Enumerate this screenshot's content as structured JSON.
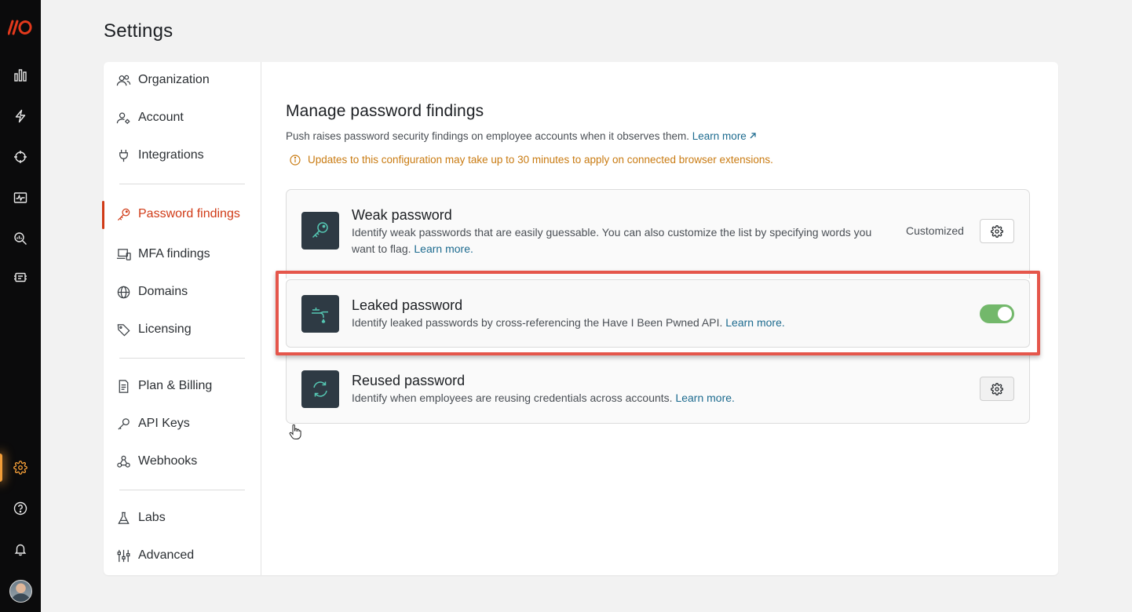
{
  "app": {
    "logo_text": "//O",
    "brand_color": "#e3391c",
    "accent_color": "#f29d38"
  },
  "rail": {
    "items": [
      {
        "icon": "bar-chart-icon"
      },
      {
        "icon": "lightning-icon"
      },
      {
        "icon": "crosshair-icon"
      },
      {
        "icon": "activity-monitor-icon"
      },
      {
        "icon": "search-analytics-icon"
      },
      {
        "icon": "browser-extension-icon"
      },
      {
        "icon": "gear-icon",
        "active": true
      },
      {
        "icon": "help-icon"
      },
      {
        "icon": "bell-icon"
      },
      {
        "icon": "avatar"
      }
    ]
  },
  "page": {
    "title": "Settings"
  },
  "settings_nav": {
    "items": [
      {
        "label": "Organization",
        "icon": "users-icon"
      },
      {
        "label": "Account",
        "icon": "user-gear-icon"
      },
      {
        "label": "Integrations",
        "icon": "plug-icon"
      },
      {
        "label": "Password findings",
        "icon": "key-icon",
        "active": true
      },
      {
        "label": "MFA findings",
        "icon": "devices-icon"
      },
      {
        "label": "Domains",
        "icon": "globe-icon"
      },
      {
        "label": "Licensing",
        "icon": "tag-icon"
      },
      {
        "label": "Plan & Billing",
        "icon": "receipt-icon"
      },
      {
        "label": "API Keys",
        "icon": "key-small-icon"
      },
      {
        "label": "Webhooks",
        "icon": "webhook-icon"
      },
      {
        "label": "Labs",
        "icon": "flask-icon"
      },
      {
        "label": "Advanced",
        "icon": "sliders-icon"
      }
    ]
  },
  "main": {
    "title": "Manage password findings",
    "description": "Push raises password security findings on employee accounts when it observes them.",
    "learn_more": "Learn more",
    "warning": "Updates to this configuration may take up to 30 minutes to apply on connected browser extensions.",
    "warning_color": "#c97b12",
    "findings": [
      {
        "title": "Weak password",
        "description": "Identify weak passwords that are easily guessable. You can also customize the list by specifying words you want to flag.",
        "link": "Learn more.",
        "status": "Customized",
        "icon": "key-icon"
      },
      {
        "title": "Leaked password",
        "description": "Identify leaked passwords by cross-referencing the Have I Been Pwned API.",
        "link": "Learn more.",
        "enabled": true,
        "toggle_color": "#73b86b",
        "icon": "leaking-faucet-icon"
      },
      {
        "title": "Reused password",
        "description": "Identify when employees are reusing credentials across accounts.",
        "link": "Learn more.",
        "icon": "refresh-icon"
      }
    ]
  }
}
